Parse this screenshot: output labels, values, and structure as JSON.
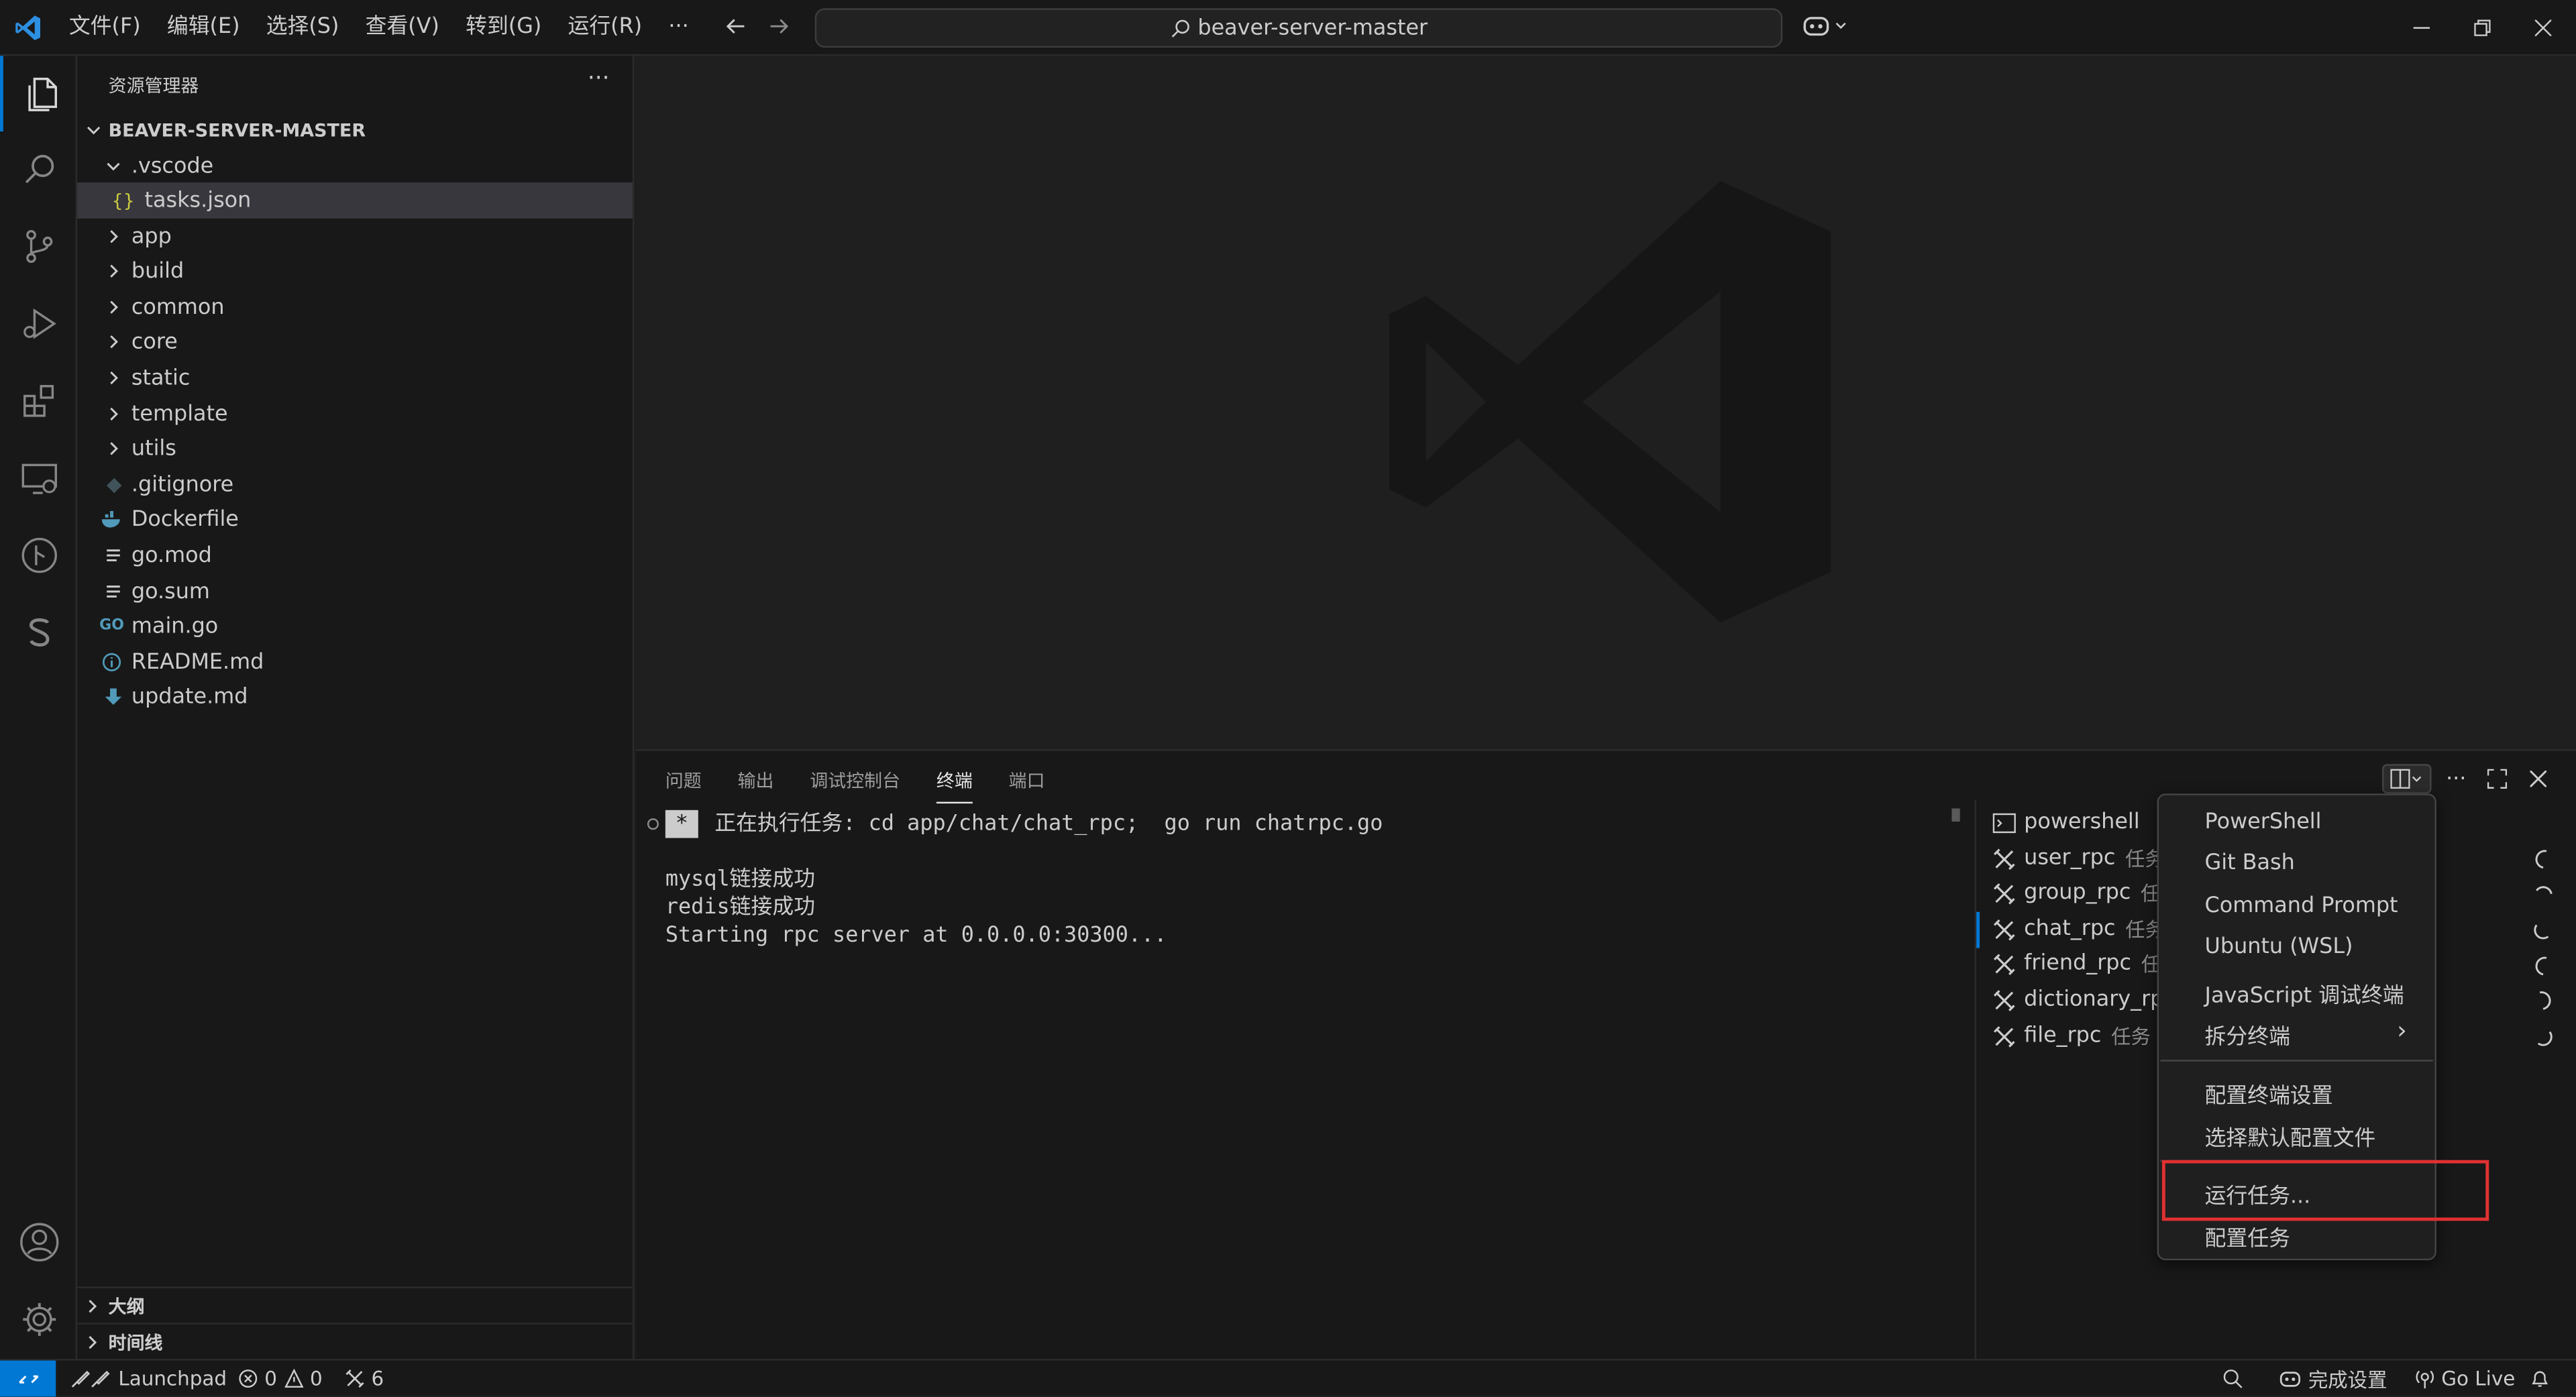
{
  "menubar": [
    "文件(F)",
    "编辑(E)",
    "选择(S)",
    "查看(V)",
    "转到(G)",
    "运行(R)",
    "···"
  ],
  "command_center": {
    "text": "beaver-server-master"
  },
  "explorer": {
    "title": "资源管理器",
    "more": "···",
    "root": "BEAVER-SERVER-MASTER",
    "folder_vscode": ".vscode",
    "file_tasks": "tasks.json",
    "tasks_icon_glyph": "{}",
    "folders": [
      "app",
      "build",
      "common",
      "core",
      "static",
      "template",
      "utils"
    ],
    "files": [
      ".gitignore",
      "Dockerfile",
      "go.mod",
      "go.sum",
      "main.go",
      "README.md",
      "update.md"
    ],
    "outline": "大纲",
    "timeline": "时间线"
  },
  "panel": {
    "tabs": [
      "问题",
      "输出",
      "调试控制台",
      "终端",
      "端口"
    ],
    "active_tab": "终端",
    "terminal_star": "*",
    "terminal_lines": [
      "正在执行任务: cd app/chat/chat_rpc;  go run chatrpc.go",
      "",
      "mysql链接成功",
      "redis链接成功",
      "Starting rpc server at 0.0.0.0:30300..."
    ],
    "terminal_list": [
      {
        "name": "powershell",
        "tag": "",
        "icon": "terminal-icon"
      },
      {
        "name": "user_rpc",
        "tag": "任务",
        "icon": "tools-icon"
      },
      {
        "name": "group_rpc",
        "tag": "任务",
        "icon": "tools-icon"
      },
      {
        "name": "chat_rpc",
        "tag": "任务",
        "icon": "tools-icon"
      },
      {
        "name": "friend_rpc",
        "tag": "任务",
        "icon": "tools-icon"
      },
      {
        "name": "dictionary_rpc",
        "tag": "",
        "icon": "tools-icon"
      },
      {
        "name": "file_rpc",
        "tag": "任务",
        "icon": "tools-icon"
      }
    ]
  },
  "context_menu": {
    "items": [
      "PowerShell",
      "Git Bash",
      "Command Prompt",
      "Ubuntu (WSL)",
      "JavaScript 调试终端",
      "拆分终端"
    ],
    "submenu_arrow": "›",
    "items2": [
      "配置终端设置",
      "选择默认配置文件"
    ],
    "items3": [
      "运行任务...",
      "配置任务"
    ],
    "highlighted": "运行任务..."
  },
  "statusbar": {
    "launchpad": "Launchpad",
    "errors": "0",
    "warnings": "0",
    "tasks": "6",
    "setup": "完成设置",
    "golive": "Go Live"
  },
  "colors": {
    "accent": "#0078d4",
    "highlight_box": "#e03131",
    "background": "#1f1f1f",
    "sidebar": "#181818"
  }
}
